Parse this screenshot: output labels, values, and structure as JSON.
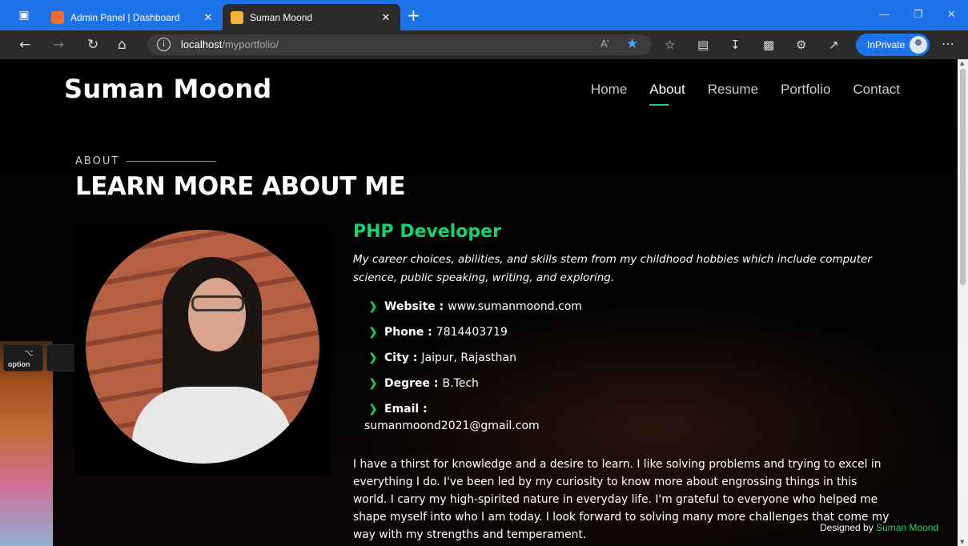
{
  "browser": {
    "tabs": [
      {
        "title": "Admin Panel | Dashboard",
        "favicon_color": "#f26b2f",
        "active": false
      },
      {
        "title": "Suman Moond",
        "favicon_color": "#f5b33a",
        "active": true
      }
    ],
    "url_host": "localhost",
    "url_path": "/myportfolio/",
    "read_aloud": "A’",
    "inprivate_label": "InPrivate",
    "accent": "#1e73e8"
  },
  "site": {
    "brand": "Suman Moond",
    "nav": [
      "Home",
      "About",
      "Resume",
      "Portfolio",
      "Contact"
    ],
    "active_nav": "About",
    "accent": "#18d26e"
  },
  "section": {
    "label": "ABOUT",
    "title": "LEARN MORE ABOUT ME"
  },
  "profile": {
    "role": "PHP Developer",
    "intro": "My career choices, abilities, and skills stem from my childhood hobbies which include computer science, public speaking, writing, and exploring.",
    "facts": [
      {
        "key": "Website :",
        "value": "www.sumanmoond.com"
      },
      {
        "key": "Phone :",
        "value": "7814403719"
      },
      {
        "key": "City :",
        "value": "Jaipur, Rajasthan"
      },
      {
        "key": "Degree :",
        "value": "B.Tech"
      },
      {
        "key": "Email :",
        "value": ""
      }
    ],
    "email": "sumanmoond2021@gmail.com",
    "about": "I have a thirst for knowledge and a desire to learn. I like solving problems and trying to excel in everything I do. I've been led by my curiosity to know more about engrossing things in this world. I carry my high-spirited nature in everyday life. I'm grateful to everyone who helped me shape myself into who I am today. I look forward to solving many more challenges that come my way with my strengths and temperament."
  },
  "footer": {
    "designed_by": "Designed by",
    "designer": "Suman Moond"
  },
  "background": {
    "key_label": "option",
    "key_symbol": "⌥"
  }
}
